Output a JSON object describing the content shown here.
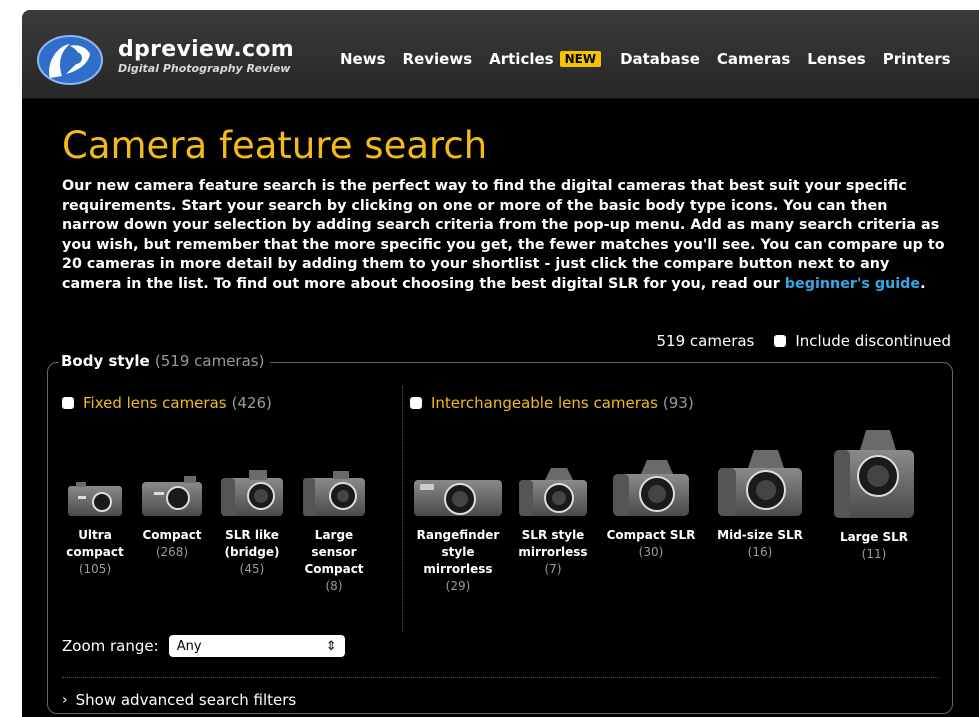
{
  "header": {
    "brand_name": "dpreview.com",
    "brand_tagline": "Digital Photography Review",
    "nav": [
      {
        "label": "News"
      },
      {
        "label": "Reviews"
      },
      {
        "label": "Articles",
        "badge": "NEW"
      },
      {
        "label": "Database"
      },
      {
        "label": "Cameras"
      },
      {
        "label": "Lenses"
      },
      {
        "label": "Printers"
      }
    ]
  },
  "page": {
    "title": "Camera feature search",
    "intro": "Our new camera feature search is the perfect way to find the digital cameras that best suit your specific requirements. Start your search by clicking on one or more of the basic body type icons. You can then narrow down your selection by adding search criteria from the pop-up menu. Add as many search criteria as you wish, but remember that the more specific you get, the fewer matches you'll see. You can compare up to 20 cameras in more detail by adding them to your shortlist - just click the compare button next to any camera in the list. To find out more about choosing the best digital SLR for you, read our",
    "intro_link": "beginner's guide",
    "intro_end": "."
  },
  "results": {
    "count": "519 cameras",
    "discontinued_label": "Include discontinued"
  },
  "body_style": {
    "legend": "Body style",
    "legend_count": "(519 cameras)",
    "fixed": {
      "label": "Fixed lens cameras",
      "count": "(426)",
      "cameras": [
        {
          "label": "Ultra\ncompact",
          "count": "(105)"
        },
        {
          "label": "Compact",
          "count": "(268)"
        },
        {
          "label": "SLR like\n(bridge)",
          "count": "(45)"
        },
        {
          "label": "Large\nsensor\nCompact",
          "count": "(8)"
        }
      ]
    },
    "interchangeable": {
      "label": "Interchangeable lens cameras",
      "count": "(93)",
      "cameras": [
        {
          "label": "Rangefinder\nstyle\nmirrorless",
          "count": "(29)"
        },
        {
          "label": "SLR style\nmirrorless",
          "count": "(7)"
        },
        {
          "label": "Compact SLR",
          "count": "(30)"
        },
        {
          "label": "Mid-size SLR",
          "count": "(16)"
        },
        {
          "label": "Large SLR",
          "count": "(11)"
        }
      ]
    }
  },
  "zoom": {
    "label": "Zoom range:",
    "value": "Any"
  },
  "advanced": {
    "label": "Show advanced search filters"
  },
  "colors": {
    "accent_yellow": "#f4bb18",
    "link_blue": "#38a7e5",
    "muted_gray": "#9a9a9a",
    "background": "#000000"
  }
}
